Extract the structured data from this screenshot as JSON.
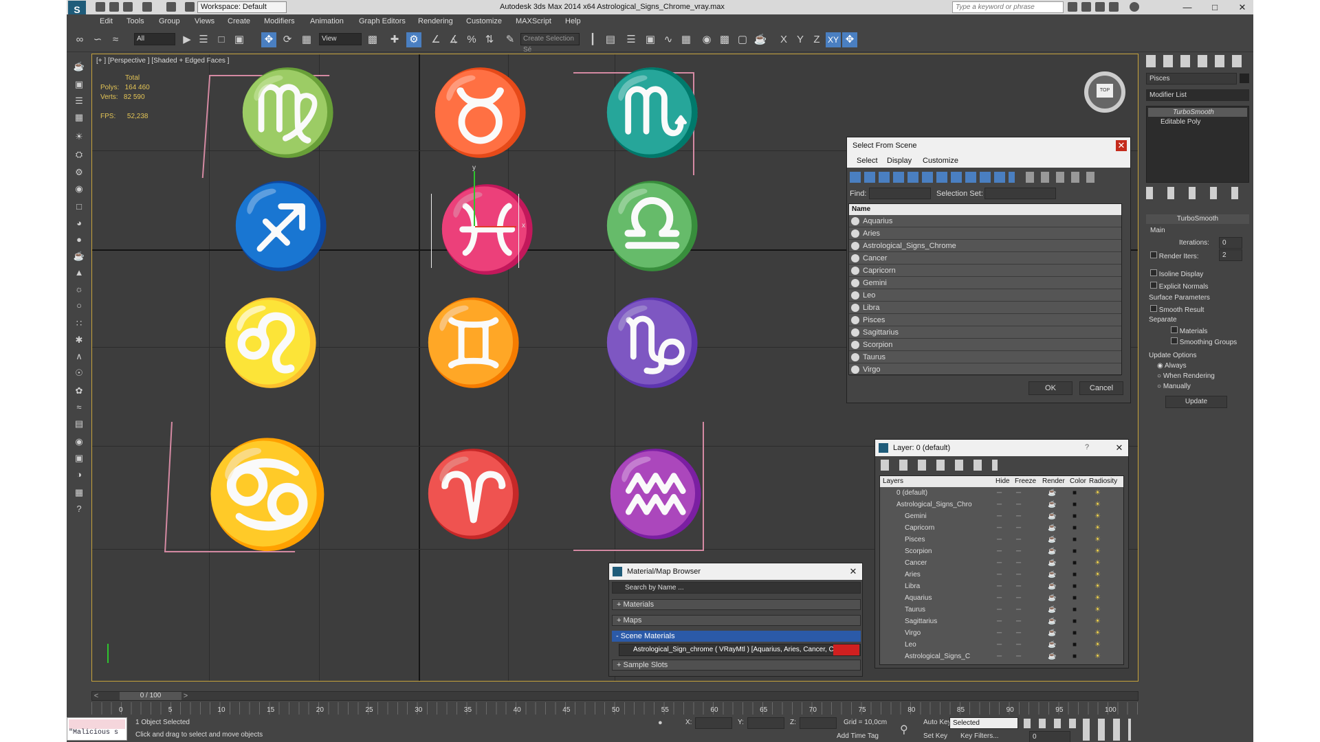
{
  "titlebar": {
    "workspace": "Workspace: Default",
    "title": "Autodesk 3ds Max  2014 x64      Astrological_Signs_Chrome_vray.max",
    "search_placeholder": "Type a keyword or phrase"
  },
  "menu": [
    "Edit",
    "Tools",
    "Group",
    "Views",
    "Create",
    "Modifiers",
    "Animation",
    "Graph Editors",
    "Rendering",
    "Customize",
    "MAXScript",
    "Help"
  ],
  "toolbar": {
    "filter": "All",
    "ref_coord": "View",
    "selection_set": "Create Selection Sé",
    "xyz": [
      "X",
      "Y",
      "Z",
      "XY"
    ]
  },
  "viewport": {
    "label": "[+ ] [Perspective ] [Shaded + Edged Faces ]",
    "stats": {
      "total": "Total",
      "polys_label": "Polys:",
      "polys": "164 460",
      "verts_label": "Verts:",
      "verts": "82 590",
      "fps_label": "FPS:",
      "fps": "52,238"
    },
    "signs": [
      "♍",
      "♉",
      "♏",
      "♐",
      "♓",
      "♎",
      "♌",
      "♊",
      "♑",
      "♋",
      "♈",
      "♒"
    ],
    "gizmo_axes": {
      "x": "x",
      "y": "y"
    },
    "viewcube": "TOP"
  },
  "select_from_scene": {
    "title": "Select From Scene",
    "menu": [
      "Select",
      "Display",
      "Customize"
    ],
    "find_label": "Find:",
    "selset_label": "Selection Set:",
    "column": "Name",
    "items": [
      "Aquarius",
      "Aries",
      "Astrological_Signs_Chrome",
      "Cancer",
      "Capricorn",
      "Gemini",
      "Leo",
      "Libra",
      "Pisces",
      "Sagittarius",
      "Scorpion",
      "Taurus",
      "Virgo"
    ],
    "ok": "OK",
    "cancel": "Cancel"
  },
  "material_browser": {
    "title": "Material/Map Browser",
    "search_placeholder": "Search by Name ...",
    "sections": [
      "+ Materials",
      "+ Maps",
      "- Scene Materials"
    ],
    "scene_material": "Astrological_Sign_chrome ( VRayMtl ) [Aquarius, Aries, Cancer, Cap...",
    "sample_slots": "+ Sample Slots"
  },
  "layer_dialog": {
    "title": "Layer: 0 (default)",
    "help": "?",
    "columns": [
      "Layers",
      "Hide",
      "Freeze",
      "Render",
      "Color",
      "Radiosity"
    ],
    "rows": [
      "0 (default)",
      "Astrological_Signs_Chro",
      "Gemini",
      "Capricorn",
      "Pisces",
      "Scorpion",
      "Cancer",
      "Aries",
      "Libra",
      "Aquarius",
      "Taurus",
      "Sagittarius",
      "Virgo",
      "Leo",
      "Astrological_Signs_C"
    ]
  },
  "command_panel": {
    "object_name": "Pisces",
    "modifier_list": "Modifier List",
    "stack": [
      "TurboSmooth",
      "Editable Poly"
    ],
    "rollout_title": "TurboSmooth",
    "main": "Main",
    "iterations_label": "Iterations:",
    "iterations": "0",
    "render_iters_label": "Render Iters:",
    "render_iters": "2",
    "isoline": "Isoline Display",
    "explicit": "Explicit Normals",
    "surface_params": "Surface Parameters",
    "smooth_result": "Smooth Result",
    "separate": "Separate",
    "materials": "Materials",
    "smoothing_groups": "Smoothing Groups",
    "update_options": "Update Options",
    "always": "Always",
    "when_rendering": "When Rendering",
    "manually": "Manually",
    "update": "Update"
  },
  "timeline": {
    "frame": "0 / 100",
    "ticks": [
      "0",
      "5",
      "10",
      "15",
      "20",
      "25",
      "30",
      "35",
      "40",
      "45",
      "50",
      "55",
      "60",
      "65",
      "70",
      "75",
      "80",
      "85",
      "90",
      "95",
      "100"
    ]
  },
  "status": {
    "script": "\"Malicious s",
    "selected": "1 Object Selected",
    "prompt": "Click and drag to select and move objects",
    "x_label": "X:",
    "y_label": "Y:",
    "z_label": "Z:",
    "grid": "Grid = 10,0cm",
    "add_time_tag": "Add Time Tag",
    "auto_key": "Auto Key",
    "set_key": "Set Key",
    "selected_dd": "Selected",
    "key_filters": "Key Filters...",
    "frame": "0"
  },
  "colors": {
    "accent": "#4a7fc1",
    "viewport_border": "#c8a33b",
    "pink": "#d58aa3",
    "highlight": "#2b5aa8"
  }
}
